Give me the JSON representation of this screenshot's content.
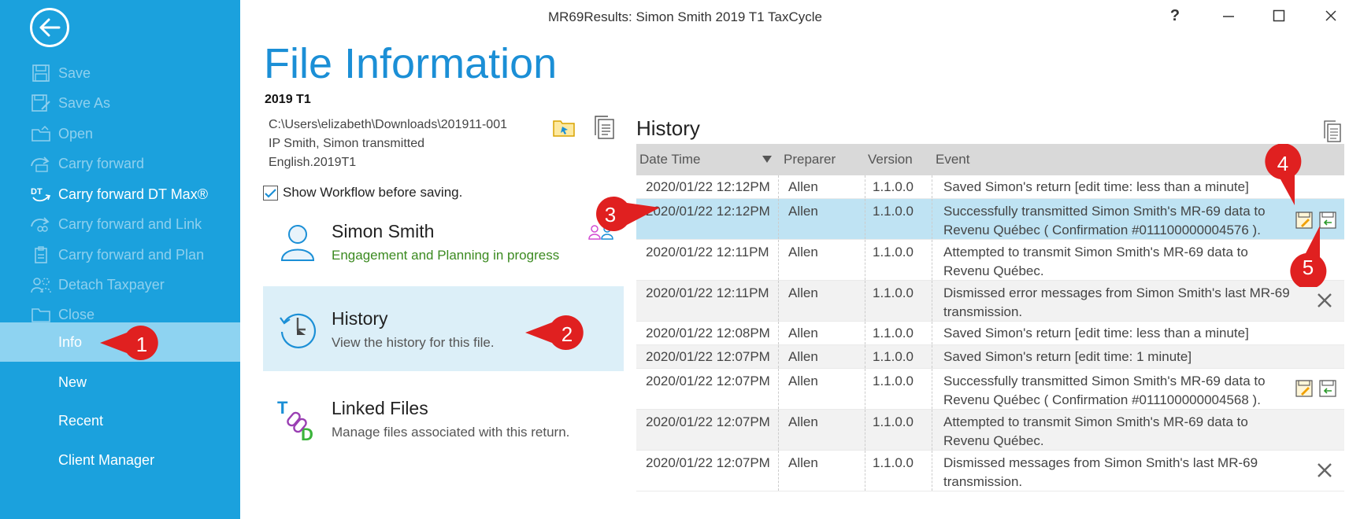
{
  "window": {
    "title": "MR69Results: Simon Smith 2019 T1 TaxCycle",
    "help": "?",
    "minimize": "—",
    "maximize": "☐",
    "close": "✕"
  },
  "sidebar": {
    "items": [
      {
        "label": "Save",
        "icon": "save-icon",
        "state": "disabled"
      },
      {
        "label": "Save As",
        "icon": "save-as-icon",
        "state": "disabled"
      },
      {
        "label": "Open",
        "icon": "open-folder-icon",
        "state": "disabled"
      },
      {
        "label": "Carry forward",
        "icon": "carry-forward-icon",
        "state": "disabled"
      },
      {
        "label": "Carry forward DT Max®",
        "icon": "dt-max-icon",
        "state": "enabled"
      },
      {
        "label": "Carry forward and Link",
        "icon": "carry-forward-link-icon",
        "state": "disabled"
      },
      {
        "label": "Carry forward and Plan",
        "icon": "carry-forward-plan-icon",
        "state": "disabled"
      },
      {
        "label": "Detach Taxpayer",
        "icon": "detach-taxpayer-icon",
        "state": "disabled"
      },
      {
        "label": "Close",
        "icon": "close-folder-icon",
        "state": "disabled"
      },
      {
        "label": "Info",
        "state": "selected"
      },
      {
        "label": "New",
        "state": "enabled"
      },
      {
        "label": "Recent",
        "state": "enabled"
      },
      {
        "label": "Client Manager",
        "state": "enabled"
      }
    ]
  },
  "main": {
    "title": "File Information",
    "version": "2019 T1",
    "path_lines": [
      "C:\\Users\\elizabeth\\Downloads\\201911-001",
      "IP Smith, Simon transmitted",
      "English.2019T1"
    ],
    "workflow_label": "Show Workflow before saving.",
    "workflow_checked": true,
    "cards": [
      {
        "title": "Simon Smith",
        "subtitle": "Engagement and Planning in progress",
        "icon": "person-icon"
      },
      {
        "title": "History",
        "subtitle": "View the history for this file.",
        "icon": "history-clock-icon"
      },
      {
        "title": "Linked Files",
        "subtitle": "Manage files associated with this return.",
        "icon": "linked-files-icon"
      }
    ]
  },
  "history": {
    "title": "History",
    "columns": [
      "Date Time",
      "Preparer",
      "Version",
      "Event"
    ],
    "rows": [
      {
        "date": "2020/01/22 12:12PM",
        "preparer": "Allen",
        "version": "1.1.0.0",
        "event": "Saved Simon's return [edit time: less than a minute]"
      },
      {
        "date": "2020/01/22 12:12PM",
        "preparer": "Allen",
        "version": "1.1.0.0",
        "event": "Successfully transmitted Simon Smith's MR-69 data to Revenu Québec ( Confirmation #011100000004576 )."
      },
      {
        "date": "2020/01/22 12:11PM",
        "preparer": "Allen",
        "version": "1.1.0.0",
        "event": "Attempted to transmit Simon Smith's MR-69 data to Revenu Québec."
      },
      {
        "date": "2020/01/22 12:11PM",
        "preparer": "Allen",
        "version": "1.1.0.0",
        "event": "Dismissed error messages from Simon Smith's last MR-69 transmission."
      },
      {
        "date": "2020/01/22 12:08PM",
        "preparer": "Allen",
        "version": "1.1.0.0",
        "event": "Saved Simon's return [edit time: less than a minute]"
      },
      {
        "date": "2020/01/22 12:07PM",
        "preparer": "Allen",
        "version": "1.1.0.0",
        "event": "Saved Simon's return [edit time: 1 minute]"
      },
      {
        "date": "2020/01/22 12:07PM",
        "preparer": "Allen",
        "version": "1.1.0.0",
        "event": "Successfully transmitted Simon Smith's MR-69 data to Revenu Québec ( Confirmation #011100000004568 )."
      },
      {
        "date": "2020/01/22 12:07PM",
        "preparer": "Allen",
        "version": "1.1.0.0",
        "event": "Attempted to transmit Simon Smith's MR-69 data to Revenu Québec."
      },
      {
        "date": "2020/01/22 12:07PM",
        "preparer": "Allen",
        "version": "1.1.0.0",
        "event": "Dismissed messages from Simon Smith's last MR-69 transmission."
      }
    ]
  },
  "callouts": [
    "1",
    "2",
    "3",
    "4",
    "5"
  ],
  "colors": {
    "sidebar": "#1ba1dd",
    "accent": "#1b8fd6",
    "callout": "#e02020",
    "selected_row": "#bfe3f3"
  }
}
